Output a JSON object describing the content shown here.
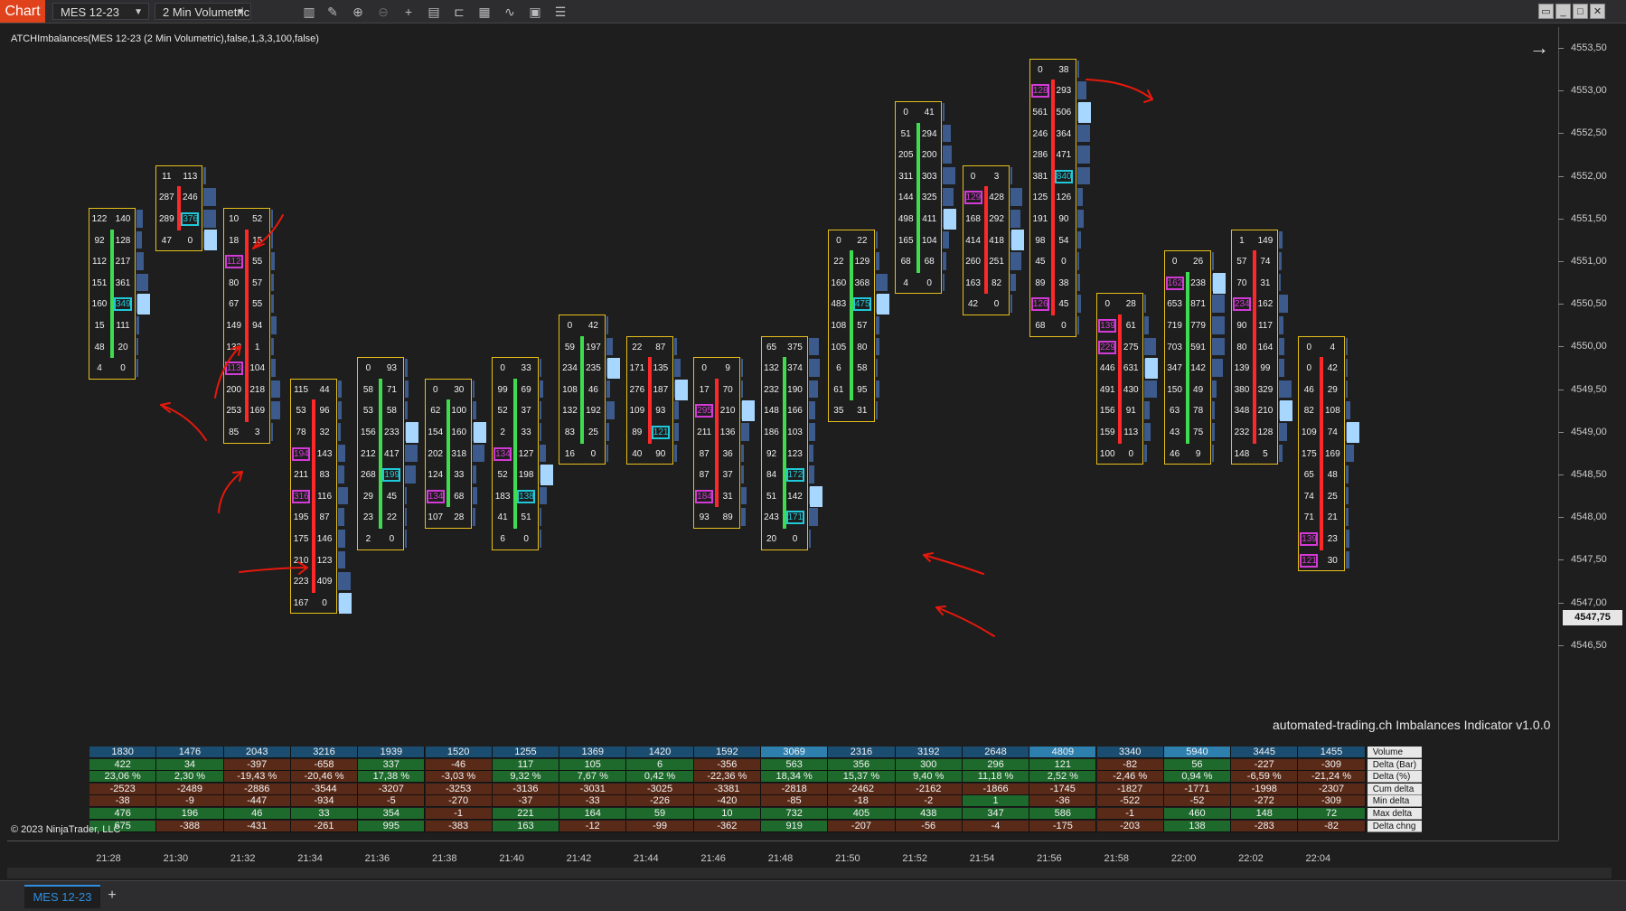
{
  "toolbar": {
    "tab_label": "Chart",
    "instrument": "MES 12-23",
    "interval": "2 Min Volumetric",
    "icons": [
      "bar-type-icon",
      "draw-icon",
      "zoom-in-icon",
      "zoom-out-icon",
      "crosshair-icon",
      "properties-icon",
      "templates-icon",
      "strategies-icon",
      "indicators-icon",
      "chart-trader-icon",
      "data-box-icon"
    ]
  },
  "indicator_label": "ATCHImbalances(MES 12-23 (2 Min Volumetric),false,1,3,3,100,false)",
  "watermark": "automated-trading.ch Imbalances Indicator v1.0.0",
  "copyright": "© 2023 NinjaTrader, LLC",
  "last_price": "4547,75",
  "price_axis": [
    "4553,50",
    "4553,00",
    "4552,50",
    "4552,00",
    "4551,50",
    "4551,00",
    "4550,50",
    "4550,00",
    "4549,50",
    "4549,00",
    "4548,50",
    "4548,00",
    "4547,50",
    "4547,00",
    "4546,50"
  ],
  "time_axis": [
    "21:28",
    "21:30",
    "21:32",
    "21:34",
    "21:36",
    "21:38",
    "21:40",
    "21:42",
    "21:44",
    "21:46",
    "21:48",
    "21:50",
    "21:52",
    "21:54",
    "21:56",
    "21:58",
    "22:00",
    "22:02",
    "22:04"
  ],
  "bottom_tab": "MES 12-23",
  "stats": {
    "row_labels": [
      "Volume",
      "Delta (Bar)",
      "Delta (%)",
      "Cum delta",
      "Min delta",
      "Max delta",
      "Delta chng"
    ],
    "columns": [
      [
        "1830",
        "422",
        "23,06 %",
        "-2523",
        "-38",
        "476",
        "675"
      ],
      [
        "1476",
        "34",
        "2,30 %",
        "-2489",
        "-9",
        "196",
        "-388"
      ],
      [
        "2043",
        "-397",
        "-19,43 %",
        "-2886",
        "-447",
        "46",
        "-431"
      ],
      [
        "3216",
        "-658",
        "-20,46 %",
        "-3544",
        "-934",
        "33",
        "-261"
      ],
      [
        "1939",
        "337",
        "17,38 %",
        "-3207",
        "-5",
        "354",
        "995"
      ],
      [
        "1520",
        "-46",
        "-3,03 %",
        "-3253",
        "-270",
        "-1",
        "-383"
      ],
      [
        "1255",
        "117",
        "9,32 %",
        "-3136",
        "-37",
        "221",
        "163"
      ],
      [
        "1369",
        "105",
        "7,67 %",
        "-3031",
        "-33",
        "164",
        "-12"
      ],
      [
        "1420",
        "6",
        "0,42 %",
        "-3025",
        "-226",
        "59",
        "-99"
      ],
      [
        "1592",
        "-356",
        "-22,36 %",
        "-3381",
        "-420",
        "10",
        "-362"
      ],
      [
        "3069",
        "563",
        "18,34 %",
        "-2818",
        "-85",
        "732",
        "919"
      ],
      [
        "2316",
        "356",
        "15,37 %",
        "-2462",
        "-18",
        "405",
        "-207"
      ],
      [
        "3192",
        "300",
        "9,40 %",
        "-2162",
        "-2",
        "438",
        "-56"
      ],
      [
        "2648",
        "296",
        "11,18 %",
        "-1866",
        "1",
        "347",
        "-4"
      ],
      [
        "4809",
        "121",
        "2,52 %",
        "-1745",
        "-36",
        "586",
        "-175"
      ],
      [
        "3340",
        "-82",
        "-2,46 %",
        "-1827",
        "-522",
        "-1",
        "-203"
      ],
      [
        "5940",
        "56",
        "0,94 %",
        "-1771",
        "-52",
        "460",
        "138"
      ],
      [
        "3445",
        "-227",
        "-6,59 %",
        "-1998",
        "-272",
        "148",
        "-283"
      ],
      [
        "1455",
        "-309",
        "-21,24 %",
        "-2307",
        "-309",
        "72",
        "-82"
      ]
    ]
  },
  "bars": [
    {
      "top": 4551.5,
      "bot": 4549.5,
      "poc": 4550.5,
      "delta": "up",
      "rows": [
        [
          "122",
          "140"
        ],
        [
          "92",
          "128"
        ],
        [
          "112",
          "217"
        ],
        [
          "151",
          "361"
        ],
        [
          "160",
          "349"
        ],
        [
          "15",
          "111"
        ],
        [
          "48",
          "20"
        ],
        [
          "4",
          "0"
        ]
      ],
      "bid_imb": [],
      "ask_imb": [
        4
      ]
    },
    {
      "top": 4552.0,
      "bot": 4551.25,
      "poc": 4551.25,
      "delta": "down",
      "rows": [
        [
          "11",
          "113"
        ],
        [
          "287",
          "246"
        ],
        [
          "289",
          "376"
        ],
        [
          "47",
          "0"
        ]
      ],
      "bid_imb": [],
      "ask_imb": [
        2
      ]
    },
    {
      "top": 4551.5,
      "bot": 4549.25,
      "poc": null,
      "delta": "down",
      "rows": [
        [
          "10",
          "52"
        ],
        [
          "18",
          "15"
        ],
        [
          "112",
          "55"
        ],
        [
          "80",
          "57"
        ],
        [
          "67",
          "55"
        ],
        [
          "149",
          "94"
        ],
        [
          "133",
          "1"
        ],
        [
          "113",
          "104"
        ],
        [
          "200",
          "218"
        ],
        [
          "253",
          "169"
        ],
        [
          "85",
          "3"
        ]
      ],
      "bid_imb": [
        2,
        7
      ],
      "ask_imb": []
    },
    {
      "top": 4549.5,
      "bot": 4546.75,
      "poc": 4547.0,
      "delta": "down",
      "rows": [
        [
          "115",
          "44"
        ],
        [
          "53",
          "96"
        ],
        [
          "78",
          "32"
        ],
        [
          "194",
          "143"
        ],
        [
          "211",
          "83"
        ],
        [
          "316",
          "116"
        ],
        [
          "195",
          "87"
        ],
        [
          "175",
          "146"
        ],
        [
          "210",
          "123"
        ],
        [
          "223",
          "409"
        ],
        [
          "167",
          "0"
        ]
      ],
      "bid_imb": [
        3,
        5
      ],
      "ask_imb": []
    },
    {
      "top": 4549.75,
      "bot": 4548.0,
      "poc": 4549.0,
      "delta": "up",
      "rows": [
        [
          "0",
          "93"
        ],
        [
          "58",
          "71"
        ],
        [
          "53",
          "58"
        ],
        [
          "156",
          "233"
        ],
        [
          "212",
          "417"
        ],
        [
          "268",
          "199"
        ],
        [
          "29",
          "45"
        ],
        [
          "23",
          "22"
        ],
        [
          "2",
          "0"
        ]
      ],
      "bid_imb": [],
      "ask_imb": [
        5
      ]
    },
    {
      "top": 4549.5,
      "bot": 4548.25,
      "poc": 4549.0,
      "delta": "up",
      "rows": [
        [
          "0",
          "30"
        ],
        [
          "62",
          "100"
        ],
        [
          "154",
          "160"
        ],
        [
          "202",
          "318"
        ],
        [
          "124",
          "33"
        ],
        [
          "134",
          "68"
        ],
        [
          "107",
          "28"
        ]
      ],
      "bid_imb": [
        5
      ],
      "ask_imb": []
    },
    {
      "top": 4549.75,
      "bot": 4548.0,
      "poc": 4548.5,
      "delta": "up",
      "rows": [
        [
          "0",
          "33"
        ],
        [
          "99",
          "69"
        ],
        [
          "52",
          "37"
        ],
        [
          "2",
          "33"
        ],
        [
          "134",
          "127"
        ],
        [
          "52",
          "198"
        ],
        [
          "183",
          "138"
        ],
        [
          "41",
          "51"
        ],
        [
          "6",
          "0"
        ]
      ],
      "bid_imb": [
        4
      ],
      "ask_imb": [
        6
      ]
    },
    {
      "top": 4550.25,
      "bot": 4549.0,
      "poc": 4549.75,
      "delta": "up",
      "rows": [
        [
          "0",
          "42"
        ],
        [
          "59",
          "197"
        ],
        [
          "234",
          "235"
        ],
        [
          "108",
          "46"
        ],
        [
          "132",
          "192"
        ],
        [
          "83",
          "25"
        ],
        [
          "16",
          "0"
        ]
      ],
      "bid_imb": [],
      "ask_imb": []
    },
    {
      "top": 4550.0,
      "bot": 4549.0,
      "poc": 4549.5,
      "delta": "down",
      "rows": [
        [
          "22",
          "87"
        ],
        [
          "171",
          "135"
        ],
        [
          "276",
          "187"
        ],
        [
          "109",
          "93"
        ],
        [
          "89",
          "121"
        ],
        [
          "40",
          "90"
        ]
      ],
      "bid_imb": [],
      "ask_imb": [
        4
      ]
    },
    {
      "top": 4549.75,
      "bot": 4548.0,
      "poc": 4549.25,
      "delta": "down",
      "rows": [
        [
          "0",
          "9"
        ],
        [
          "17",
          "70"
        ],
        [
          "295",
          "210"
        ],
        [
          "211",
          "136"
        ],
        [
          "87",
          "36"
        ],
        [
          "87",
          "37"
        ],
        [
          "184",
          "31"
        ],
        [
          "93",
          "89"
        ]
      ],
      "bid_imb": [
        2,
        6
      ],
      "ask_imb": []
    },
    {
      "top": 4550.0,
      "bot": 4547.75,
      "poc": 4548.25,
      "delta": "up",
      "rows": [
        [
          "65",
          "375"
        ],
        [
          "132",
          "374"
        ],
        [
          "232",
          "190"
        ],
        [
          "148",
          "166"
        ],
        [
          "186",
          "103"
        ],
        [
          "92",
          "123"
        ],
        [
          "84",
          "172"
        ],
        [
          "51",
          "142"
        ],
        [
          "243",
          "171"
        ],
        [
          "20",
          "0"
        ]
      ],
      "bid_imb": [],
      "ask_imb": [
        6,
        8
      ]
    },
    {
      "top": 4551.25,
      "bot": 4549.25,
      "poc": 4550.5,
      "delta": "up",
      "rows": [
        [
          "0",
          "22"
        ],
        [
          "22",
          "129"
        ],
        [
          "160",
          "368"
        ],
        [
          "483",
          "475"
        ],
        [
          "108",
          "57"
        ],
        [
          "105",
          "80"
        ],
        [
          "6",
          "58"
        ],
        [
          "61",
          "95"
        ],
        [
          "35",
          "31"
        ]
      ],
      "bid_imb": [],
      "ask_imb": [
        3
      ]
    },
    {
      "top": 4552.75,
      "bot": 4550.75,
      "poc": 4551.5,
      "delta": "up",
      "rows": [
        [
          "0",
          "41"
        ],
        [
          "51",
          "294"
        ],
        [
          "205",
          "200"
        ],
        [
          "311",
          "303"
        ],
        [
          "144",
          "325"
        ],
        [
          "498",
          "411"
        ],
        [
          "165",
          "104"
        ],
        [
          "68",
          "68"
        ],
        [
          "4",
          "0"
        ]
      ],
      "bid_imb": [],
      "ask_imb": []
    },
    {
      "top": 4552.0,
      "bot": 4550.5,
      "poc": 4551.25,
      "delta": "down",
      "rows": [
        [
          "0",
          "3"
        ],
        [
          "129",
          "428"
        ],
        [
          "168",
          "292"
        ],
        [
          "414",
          "418"
        ],
        [
          "260",
          "251"
        ],
        [
          "163",
          "82"
        ],
        [
          "42",
          "0"
        ]
      ],
      "bid_imb": [
        1
      ],
      "ask_imb": []
    },
    {
      "top": 4553.25,
      "bot": 4550.25,
      "poc": 4552.75,
      "delta": "down",
      "rows": [
        [
          "0",
          "38"
        ],
        [
          "128",
          "293"
        ],
        [
          "561",
          "506"
        ],
        [
          "246",
          "364"
        ],
        [
          "286",
          "471"
        ],
        [
          "381",
          "840"
        ],
        [
          "125",
          "126"
        ],
        [
          "191",
          "90"
        ],
        [
          "98",
          "54"
        ],
        [
          "45",
          "0"
        ],
        [
          "89",
          "38"
        ],
        [
          "126",
          "45"
        ],
        [
          "68",
          "0"
        ]
      ],
      "bid_imb": [
        1,
        11
      ],
      "ask_imb": [
        5
      ]
    },
    {
      "top": 4550.5,
      "bot": 4549.0,
      "poc": 4549.75,
      "delta": "down",
      "rows": [
        [
          "0",
          "28"
        ],
        [
          "139",
          "61"
        ],
        [
          "229",
          "275"
        ],
        [
          "446",
          "631"
        ],
        [
          "491",
          "430"
        ],
        [
          "156",
          "91"
        ],
        [
          "159",
          "113"
        ],
        [
          "100",
          "0"
        ]
      ],
      "bid_imb": [
        1,
        2
      ],
      "ask_imb": []
    },
    {
      "top": 4551.0,
      "bot": 4549.5,
      "poc": 4550.75,
      "delta": "up",
      "rows": [
        [
          "0",
          "26"
        ],
        [
          "162",
          "238"
        ],
        [
          "653",
          "871"
        ],
        [
          "719",
          "779"
        ],
        [
          "703",
          "591"
        ],
        [
          "347",
          "142"
        ],
        [
          "150",
          "49"
        ],
        [
          "63",
          "78"
        ],
        [
          "43",
          "75"
        ],
        [
          "46",
          "9"
        ]
      ],
      "bid_imb": [
        1
      ],
      "ask_imb": []
    },
    {
      "top": 4551.25,
      "bot": 4548.5,
      "poc": 4549.25,
      "delta": "down",
      "rows": [
        [
          "1",
          "149"
        ],
        [
          "57",
          "74"
        ],
        [
          "70",
          "31"
        ],
        [
          "234",
          "162"
        ],
        [
          "90",
          "117"
        ],
        [
          "80",
          "164"
        ],
        [
          "139",
          "99"
        ],
        [
          "380",
          "329"
        ],
        [
          "348",
          "210"
        ],
        [
          "232",
          "128"
        ],
        [
          "148",
          "5"
        ]
      ],
      "bid_imb": [
        3
      ],
      "ask_imb": []
    },
    {
      "top": 4550.0,
      "bot": 4547.75,
      "poc": 4549.0,
      "delta": "down",
      "rows": [
        [
          "0",
          "4"
        ],
        [
          "0",
          "42"
        ],
        [
          "46",
          "29"
        ],
        [
          "82",
          "108"
        ],
        [
          "109",
          "74"
        ],
        [
          "175",
          "169"
        ],
        [
          "65",
          "48"
        ],
        [
          "74",
          "25"
        ],
        [
          "71",
          "21"
        ],
        [
          "139",
          "23"
        ],
        [
          "121",
          "30"
        ]
      ],
      "bid_imb": [
        9,
        10
      ],
      "ask_imb": []
    }
  ],
  "colors": {
    "box": "#e7c01a",
    "bid_imb": "#d43ad6",
    "ask_imb": "#20c8d8",
    "up": "#3fdc4f",
    "down": "#ff2828",
    "poc": "#a7d6ff",
    "profile": "#3c5a8c"
  }
}
